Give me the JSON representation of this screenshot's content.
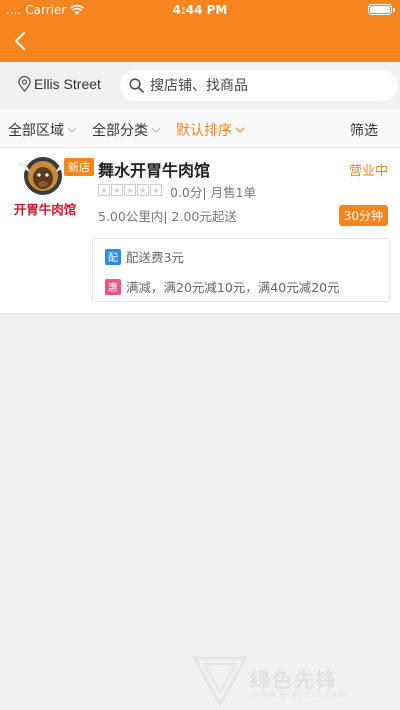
{
  "status_bar": {
    "carrier": "Carrier",
    "time": "4:44 PM"
  },
  "location": {
    "label": "Ellis Street"
  },
  "search": {
    "placeholder": "搜店铺、找商品"
  },
  "filters": {
    "area": "全部区域",
    "category": "全部分类",
    "sort": "默认排序",
    "filter": "筛选"
  },
  "shop": {
    "name": "舞水开胃牛肉馆",
    "logo_text": "开胃牛肉馆",
    "new_badge": "新店",
    "status": "营业中",
    "rating_text": "0.0分| 月售1单",
    "rating_stars": 0,
    "delivery_text": "5.00公里内| 2.00元起送",
    "time_badge": "30分钟",
    "promotions": [
      {
        "tag": "配",
        "text": "配送费3元"
      },
      {
        "tag": "惠",
        "text": "满减，满20元减10元，满40元减20元"
      }
    ]
  },
  "watermark": {
    "text": "绿色先锋",
    "url": "www.greenxf.com"
  },
  "colors": {
    "accent": "#f6851f",
    "tag_delivery": "#2b8ee3",
    "tag_discount": "#f0548a"
  }
}
